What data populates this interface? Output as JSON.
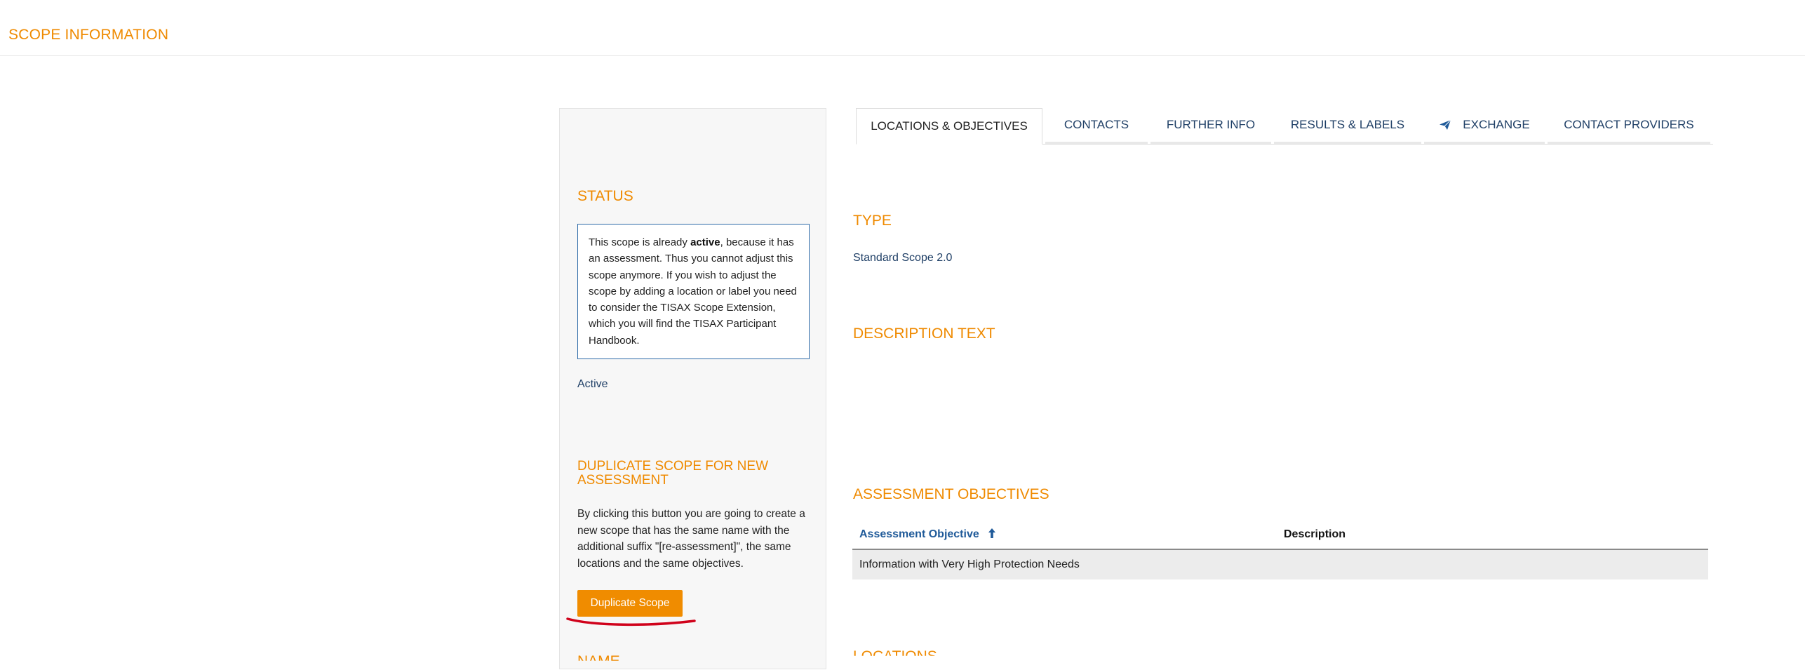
{
  "header": {
    "title": "SCOPE INFORMATION"
  },
  "left_panel": {
    "status": {
      "heading": "STATUS",
      "message_part1": "This scope is already ",
      "message_bold": "active",
      "message_part2": ", because it has an assessment. Thus you cannot adjust this scope anymore. If you wish to adjust the scope by adding a location or label you need to consider the TISAX Scope Extension, which you will find the TISAX Participant Handbook.",
      "value": "Active"
    },
    "duplicate": {
      "heading": "DUPLICATE SCOPE FOR NEW ASSESSMENT",
      "text": "By clicking this button you are going to create a new scope that has the same name with the additional suffix \"[re-assessment]\", the same locations and the same objectives.",
      "button_label": "Duplicate Scope"
    },
    "next_heading": "NAME"
  },
  "tabs": [
    {
      "label": "LOCATIONS & OBJECTIVES",
      "active": true
    },
    {
      "label": "CONTACTS",
      "active": false
    },
    {
      "label": "FURTHER INFO",
      "active": false
    },
    {
      "label": "RESULTS & LABELS",
      "active": false
    },
    {
      "label": "EXCHANGE",
      "active": false,
      "icon": "paper-plane-icon"
    },
    {
      "label": "CONTACT PROVIDERS",
      "active": false
    }
  ],
  "main": {
    "type": {
      "heading": "TYPE",
      "value": "Standard Scope 2.0"
    },
    "description": {
      "heading": "DESCRIPTION TEXT",
      "value": ""
    },
    "objectives": {
      "heading": "ASSESSMENT OBJECTIVES",
      "columns": [
        "Assessment Objective",
        "Description"
      ],
      "sort_icon": "arrow-up-icon",
      "rows": [
        {
          "objective": "Information with Very High Protection Needs",
          "description": ""
        }
      ]
    },
    "locations": {
      "heading": "LOCATIONS"
    }
  },
  "colors": {
    "accent_orange": "#ef8a00",
    "link_blue": "#1f3f66",
    "box_border": "#2d6aa8",
    "annotation_red": "#d0021b"
  }
}
